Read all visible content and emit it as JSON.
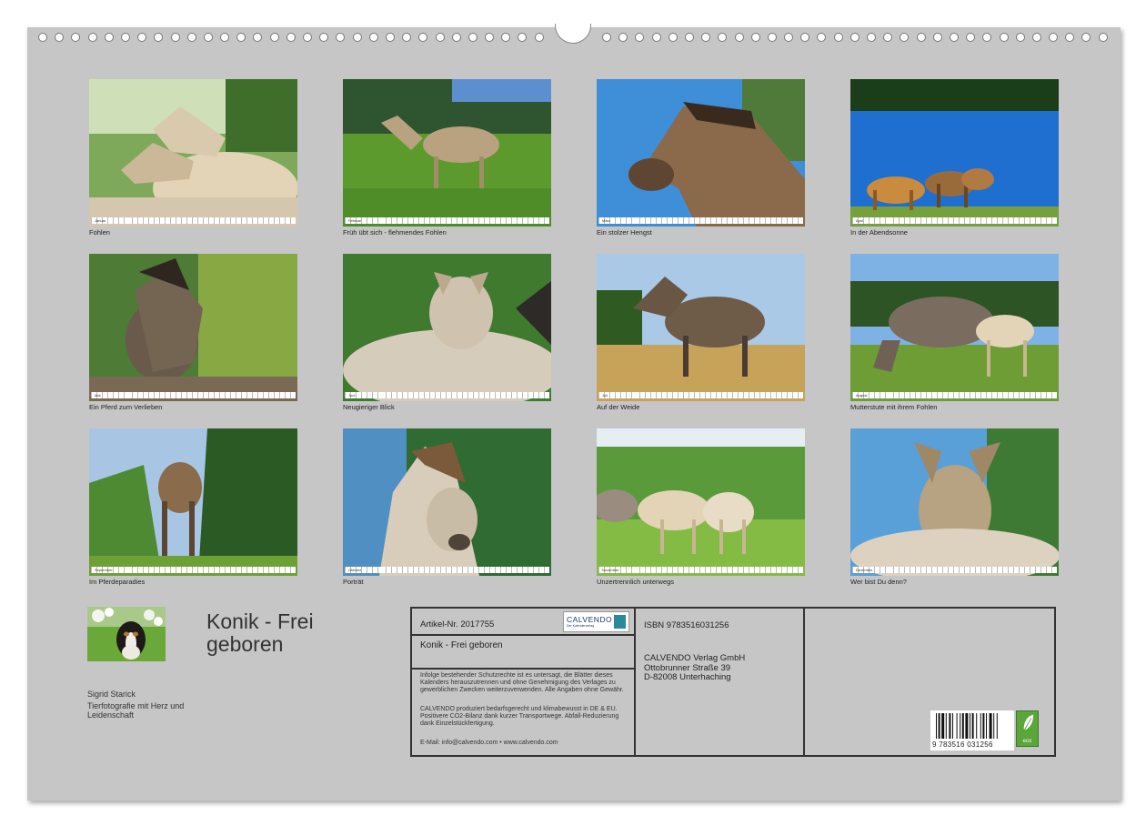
{
  "months": [
    {
      "label": "Januar",
      "caption": "Fohlen"
    },
    {
      "label": "Februar",
      "caption": "Früh übt sich - flehmendes Fohlen"
    },
    {
      "label": "März",
      "caption": "Ein stolzer Hengst"
    },
    {
      "label": "April",
      "caption": "In der Abendsonne"
    },
    {
      "label": "Mai",
      "caption": "Ein Pferd zum Verlieben"
    },
    {
      "label": "Juni",
      "caption": "Neugieriger Blick"
    },
    {
      "label": "Juli",
      "caption": "Auf der Weide"
    },
    {
      "label": "August",
      "caption": "Mutterstute mit ihrem Fohlen"
    },
    {
      "label": "September",
      "caption": "Im Pferdeparadies"
    },
    {
      "label": "Oktober",
      "caption": "Porträt"
    },
    {
      "label": "November",
      "caption": "Unzertrennlich unterwegs"
    },
    {
      "label": "Dezember",
      "caption": "Wer bist Du denn?"
    }
  ],
  "cover": {
    "title": "Konik - Frei geboren",
    "author": "Sigrid Starick",
    "tagline": "Tierfotografie mit Herz und Leidenschaft"
  },
  "info": {
    "artikel": "Artikel-Nr. 2017755",
    "logo_word": "CALVENDO",
    "logo_sub": "Der Kalenderverlag",
    "product_title": "Konik - Frei geboren",
    "legal_1": "Infolge bestehender Schutzrechte ist es untersagt, die Blätter dieses Kalenders herauszutrennen und ohne Genehmigung des Verlages zu gewerblichen Zwecken weiterzuverwenden. Alle Angaben ohne Gewähr.",
    "legal_2": "CALVENDO produziert bedarfsgerecht und klimabewusst in DE & EU. Positivere CO2-Bilanz dank kurzer Transportwege. Abfall-Reduzierung dank Einzelstückfertigung.",
    "contact": "E-Mail: info@calvendo.com • www.calvendo.com",
    "isbn": "ISBN 9783516031256",
    "publisher_name": "CALVENDO Verlag GmbH",
    "publisher_street": "Ottobrunner Straße 39",
    "publisher_city": "D-82008 Unterhaching",
    "barcode_number": "9 783516 031256",
    "eco_word": "eco"
  },
  "colors": {
    "sheet": "#c6c6c6",
    "sky": "#3e8fd8",
    "grass": "#5c9a2e",
    "forest": "#2f5a22",
    "konik_dun": "#b9a27f",
    "foal_cream": "#e3d4b8",
    "eco_green": "#5aa63a"
  }
}
